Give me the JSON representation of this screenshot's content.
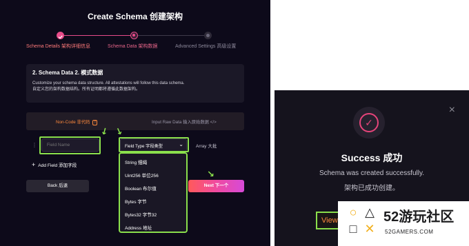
{
  "left_panel": {
    "title": "Create Schema  创建架构",
    "steps": [
      {
        "label": "Schema Details  架构详细信息",
        "state": "done"
      },
      {
        "label": "Schema Data  架构数据",
        "state": "active"
      },
      {
        "label": "Advanced Settings  高级设置",
        "state": "pending"
      }
    ],
    "section": {
      "heading": "2. Schema Data  2. 模式数据",
      "description_en": "Customize your schema data structure. All attestations will follow this data schema.",
      "description_zh": "自定义您的架构数据结构。所有证明都将遵循此数据架构。"
    },
    "tabs": {
      "non_code": "Non-Code  非代码",
      "non_code_icon": "T",
      "raw_input": "Input Raw Data  输入原始数据  </>"
    },
    "field_row": {
      "grip_icon": "⋮⋮",
      "field_name_placeholder": "Field Name",
      "field_type_label": "Field Type  字段类型",
      "field_type_chevron": "⌄",
      "array_label": "Array  大批"
    },
    "field_type_options": [
      "String  细绳",
      "Uint256  单位256",
      "Boolean  布尔值",
      "Bytes  字节",
      "Bytes32  字节32",
      "Address  地址"
    ],
    "add_field_label": "Add Field  添加字段",
    "add_field_icon": "+",
    "back_label": "Back  后退",
    "next_label": "Next  下一个"
  },
  "right_panel": {
    "close_icon": "×",
    "check_icon": "✓",
    "title": "Success  成功",
    "message_en": "Schema was created successfully.",
    "message_zh": "架构已成功创建。",
    "view_label": "View"
  },
  "watermark": {
    "name": "52游玩社区",
    "url": "52GAMERS.COM",
    "logo_glyphs": [
      "○",
      "△",
      "□",
      "✕"
    ]
  },
  "colors": {
    "highlight": "#8be04c",
    "accent_orange": "#ff8a3d",
    "accent_pink": "#e6447a",
    "background": "#0d0a1a"
  }
}
